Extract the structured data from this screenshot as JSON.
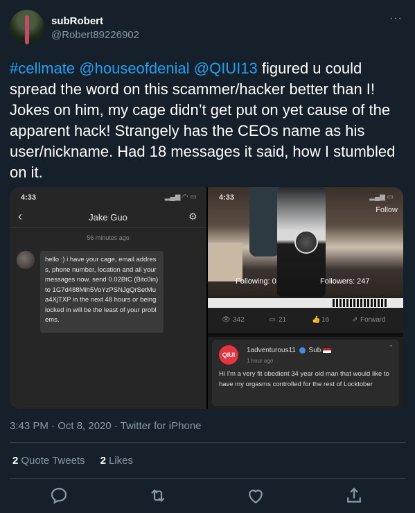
{
  "user": {
    "name": "subRobert",
    "handle": "@Robert89226902",
    "more_label": "···"
  },
  "tweet": {
    "mentions": [
      "#cellmate",
      "@houseofdenial",
      "@QIUI13"
    ],
    "text": "figured u could spread the word on this scammer/hacker better than I! Jokes on him, my cage didn’t get put on yet cause of the apparent hack! Strangely has the CEOs name as his user/nickname. Had 18 messages it said, how I stumbled on it.",
    "meta": "3:43 PM · Oct 8, 2020 · Twitter for iPhone"
  },
  "left_shot": {
    "time": "4:33",
    "title": "Jake Guo",
    "stamp": "56 minutes ago",
    "message": "hello :) i have your cage, email address, phone number, location and all your messages now. send 0.02BtC (Bitc0in) to 1G7d488Mih5VoYzPSNJgQrSetMua4XjTXP in the next 48 hours or being locked in will be the least of your problems."
  },
  "right_shot": {
    "time": "4:33",
    "follow": "Follow",
    "following": "Following:  0",
    "followers": "Followers:  247",
    "stats": {
      "views": "342",
      "comments": "21",
      "likes": "16",
      "forward": "Forward"
    },
    "comment": {
      "logo": "QIUI",
      "user": "1adventurous11",
      "badge": "Sub",
      "time": "1 hour ago",
      "body": "Hi I'm a very fit obedient 34 year old man that would like to have my orgasms controlled for the rest of Locktober"
    }
  },
  "engagement": {
    "quote_count": "2",
    "quote_label": "Quote Tweets",
    "like_count": "2",
    "like_label": "Likes"
  },
  "colors": {
    "background": "#15202b",
    "link": "#1da1f2",
    "muted": "#8899a6",
    "divider": "#38444d"
  },
  "icons": [
    "reply-icon",
    "retweet-icon",
    "like-icon",
    "share-icon"
  ]
}
